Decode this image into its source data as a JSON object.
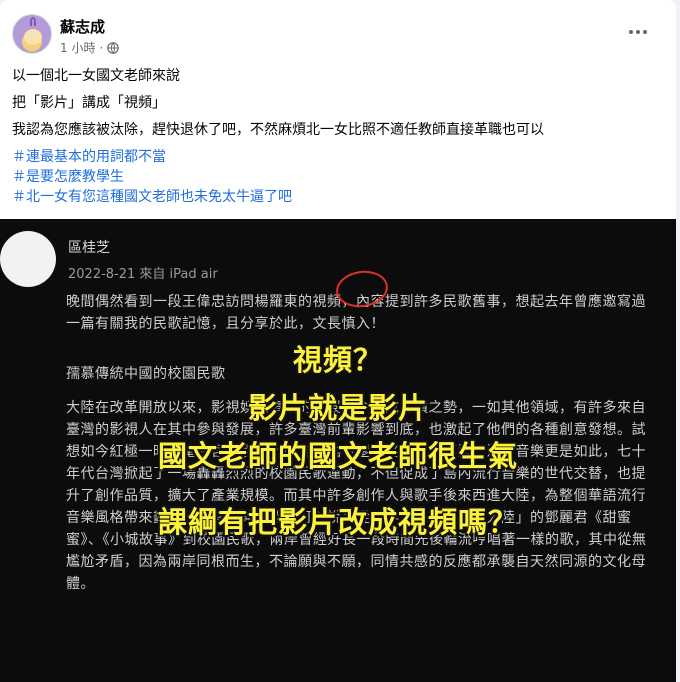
{
  "post": {
    "author": "蘇志成",
    "time": "1 小時",
    "meta_separator": "·",
    "paragraphs": [
      "以一個北一女國文老師來說",
      "把「影片」講成「視頻」",
      "我認為您應該被汰除，趕快退休了吧，不然麻煩北一女比照不適任教師直接革職也可以"
    ],
    "hashtags": [
      "＃連最基本的用詞都不當",
      "＃是要怎麼教學生",
      "＃北一女有您這種國文老師也未免太牛逼了吧"
    ],
    "icons": {
      "privacy": "globe-icon",
      "menu": "more-options-icon"
    }
  },
  "screenshot": {
    "name": "區桂芝",
    "date": "2022-8-21 來自 iPad air",
    "paragraphs": [
      "晚間偶然看到一段王偉忠訪問楊羅東的視頻，內容提到許多民歌舊事，想起去年曾應邀寫過一篇有關我的民歌記憶，且分享於此，文長慎入！",
      "孺慕傳統中國的校園民歌",
      "大陸在改革開放以來，影視娛樂事業的發展至今已成井噴之勢，一如其他領域，有許多來自臺灣的影視人在其中參與發展，許多臺灣前輩影響到底，也激起了他們的各種創意發想。試想如今紅極一時的電視宮鬥劇豈不來自瓊瑤《還珠格格》的模型？流行音樂更是如此，七十年代台灣掀起了一場轟轟烈烈的校園民歌運動，不但促成了島內流行音樂的世代交替，也提升了創作品質，擴大了產業規模。而其中許多創作人與歌手後來西進大陸，為整個華語流行音樂風格帶來劃時代的轉變與影響。可以說：從最早以聲音「反攻大陸」的鄧麗君《甜蜜蜜》、《小城故事》到校園民歌，兩岸曾經好長一段時間先後輪流哼唱著一樣的歌，其中從無尷尬矛盾，因為兩岸同根而生，不論願與不願，同情共感的反應都承襲自天然同源的文化母體。"
    ],
    "overlay_lines": [
      "視頻？",
      "影片就是影片",
      "國文老師的國文老師很生氣",
      "課綱有把影片改成視頻嗎？"
    ],
    "colors": {
      "overlay_text": "#fdf23b",
      "circle": "#e0302a",
      "background": "#0c0c0d"
    }
  }
}
